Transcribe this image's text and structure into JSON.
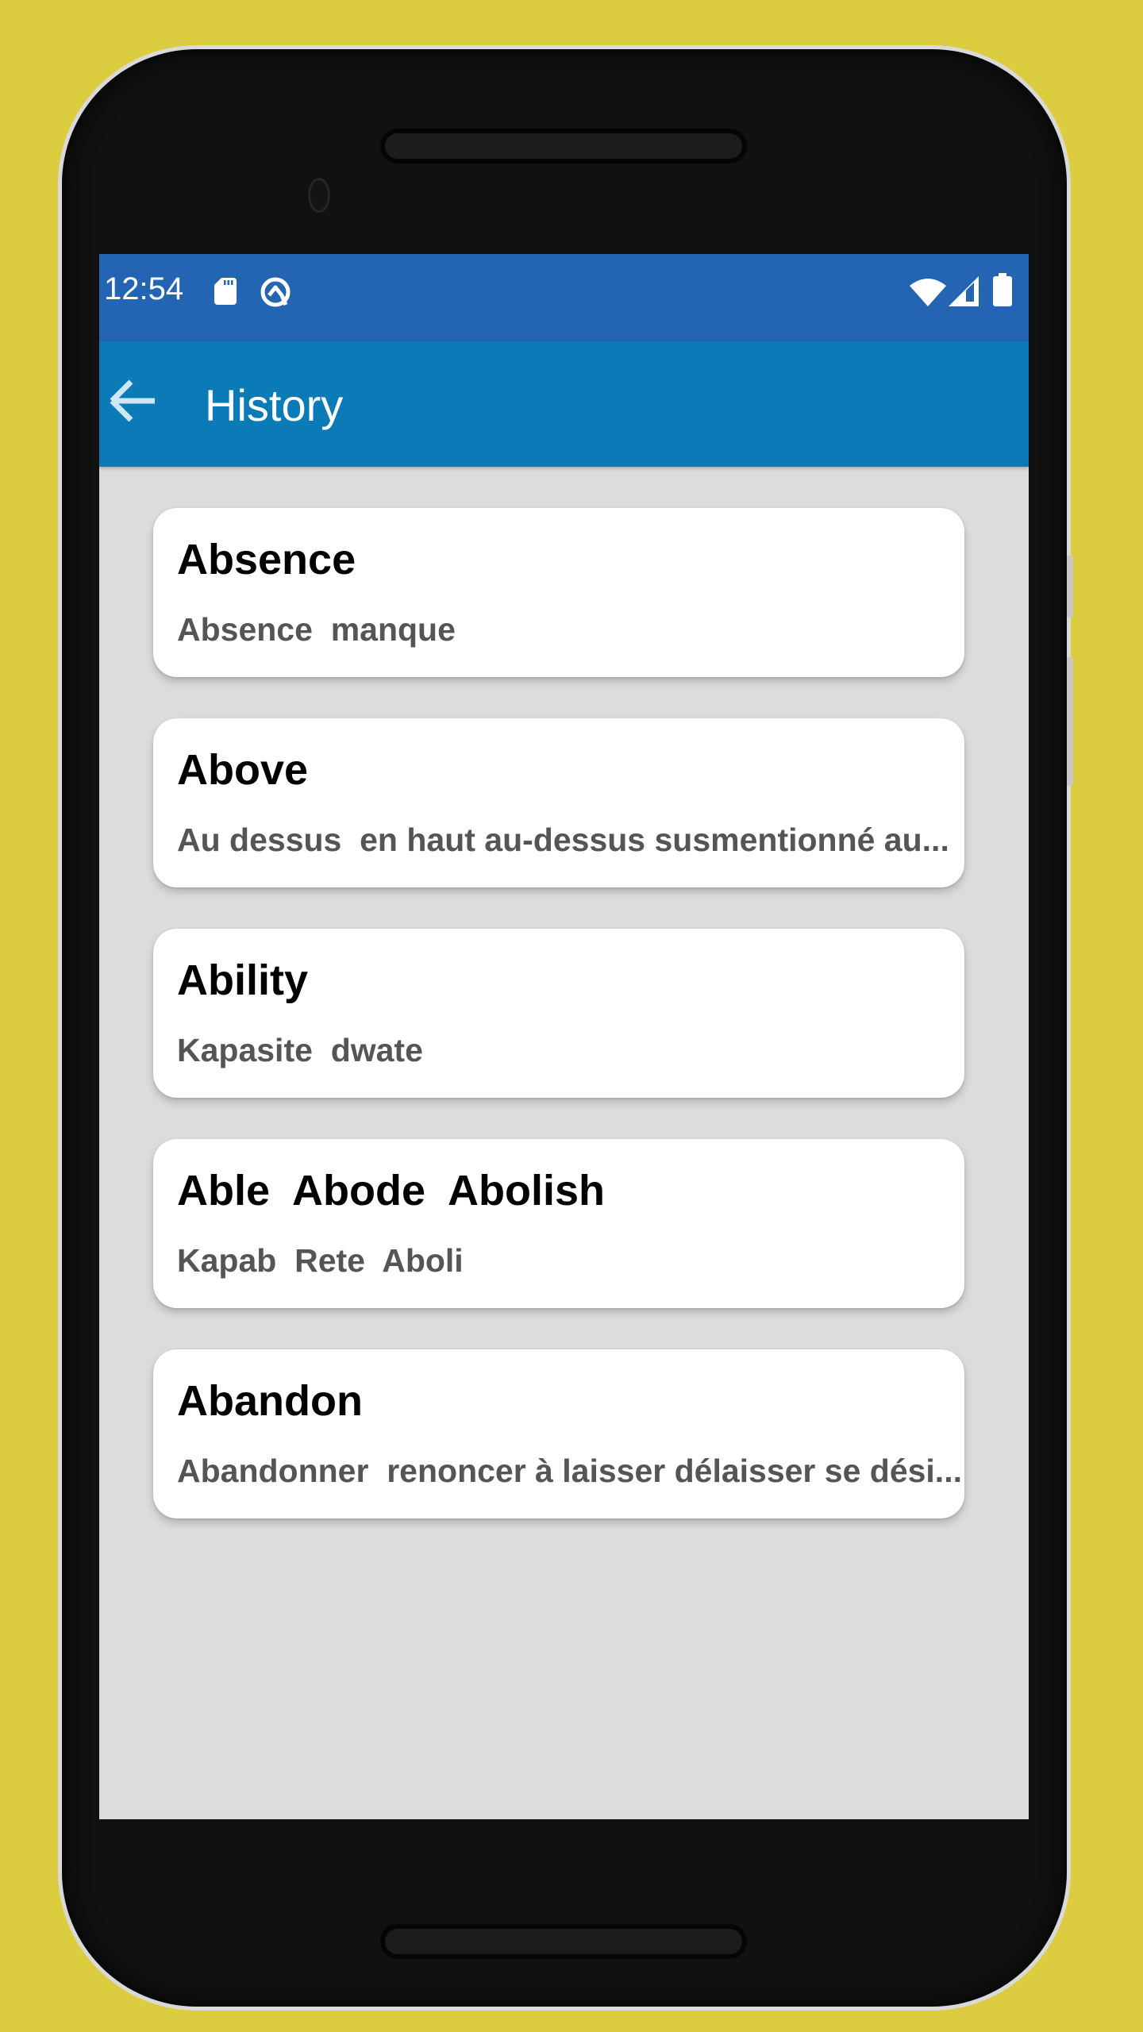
{
  "status_bar": {
    "time": "12:54",
    "icons": [
      "sd-card-icon",
      "q-icon",
      "wifi-icon",
      "signal-icon",
      "battery-icon"
    ]
  },
  "app_bar": {
    "back_icon": "arrow-left-icon",
    "title": "History"
  },
  "colors": {
    "background": "#dccc3f",
    "status_bar": "#2364b3",
    "app_bar": "#0b7bb8",
    "screen_bg": "#dcdcdc",
    "card": "#ffffff",
    "title_text": "#000000",
    "subtitle_text": "#555555"
  },
  "history": [
    {
      "word": "Absence",
      "translation": "Absence  manque"
    },
    {
      "word": "Above",
      "translation": "Au dessus  en haut au-dessus susmentionné au..."
    },
    {
      "word": "Ability",
      "translation": "Kapasite  dwate"
    },
    {
      "word": "Able  Abode  Abolish",
      "translation": "Kapab  Rete  Aboli"
    },
    {
      "word": "Abandon",
      "translation": "Abandonner  renoncer à laisser délaisser se dési..."
    }
  ]
}
